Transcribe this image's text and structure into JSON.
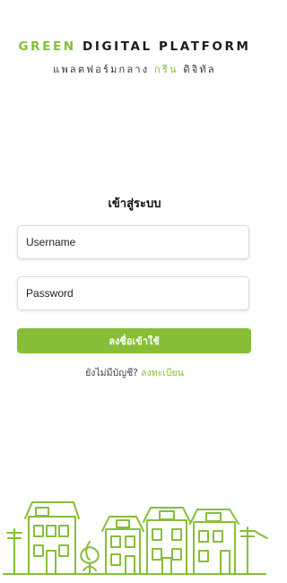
{
  "brand": {
    "title_green": "GREEN",
    "title_rest": "DIGITAL PLATFORM",
    "subtitle_before": "แพลตฟอร์มกลาง",
    "subtitle_green": "กรีน",
    "subtitle_after": "ดิจิทัล"
  },
  "login": {
    "title": "เข้าสู่ระบบ",
    "username_placeholder": "Username",
    "password_placeholder": "Password",
    "submit_label": "ลงชื่อเข้าใช้",
    "no_account_text": "ยังไม่มีบัญชี?",
    "register_link": "ลงทะเบียน"
  },
  "colors": {
    "accent": "#86bf37",
    "text": "#222222",
    "background": "#ffffff"
  },
  "icons": [
    "town-illustration"
  ]
}
